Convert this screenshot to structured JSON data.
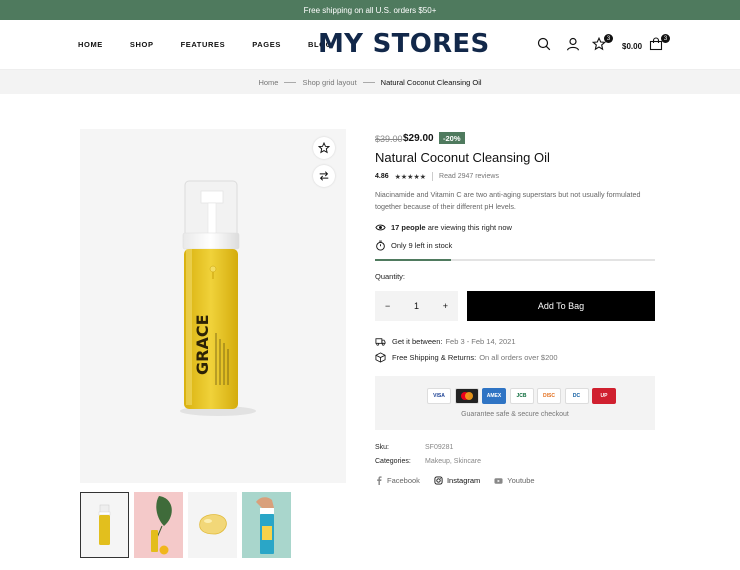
{
  "announcement": "Free shipping on all U.S. orders $50+",
  "nav": [
    "HOME",
    "SHOP",
    "FEATURES",
    "PAGES",
    "BLOG"
  ],
  "logo": "MY STORES",
  "header": {
    "wishlist_count": "3",
    "cart_count": "3",
    "cart_total": "$0.00"
  },
  "breadcrumb": [
    "Home",
    "Shop grid layout",
    "Natural Coconut Cleansing Oil"
  ],
  "product": {
    "price_old": "$39.00",
    "price_new": "$29.00",
    "discount": "-20%",
    "title": "Natural Coconut Cleansing Oil",
    "rating": "4.86",
    "stars": "★★★★★",
    "reviews": "Read 2947 reviews",
    "description": "Niacinamide and Vitamin C are two anti-aging superstars but not usually formulated together because of their different pH levels.",
    "viewing_count": "17 people",
    "viewing_text": "are viewing this right now",
    "stock": "Only 9 left in stock",
    "stock_progress": 0.27,
    "quantity_label": "Quantity:",
    "quantity": "1",
    "minus": "−",
    "plus": "+",
    "add_to_bag": "Add To Bag",
    "delivery_label": "Get it between:",
    "delivery_dates": "Feb 3 - Feb 14, 2021",
    "shipping_label": "Free Shipping & Returns:",
    "shipping_text": "On all orders over $200",
    "payment_cards": [
      "VISA",
      "MC",
      "AMEX",
      "JCB",
      "DISC",
      "DC",
      "UP"
    ],
    "guarantee": "Guarantee safe & secure checkout",
    "sku_label": "Sku:",
    "sku": "SF09281",
    "categories_label": "Categories:",
    "categories": "Makeup, Skincare",
    "social": [
      "Facebook",
      "Instagram",
      "Youtube"
    ],
    "bottle_brand": "GRACE"
  },
  "colors": {
    "accent": "#4f7a5e",
    "logo": "#12284a",
    "oil": "#e8c51c"
  },
  "icons": [
    "search-icon",
    "user-icon",
    "star-icon",
    "bag-icon",
    "compare-icon",
    "eye-icon",
    "timer-icon",
    "truck-icon",
    "box-icon",
    "facebook-icon",
    "instagram-icon",
    "youtube-icon"
  ]
}
